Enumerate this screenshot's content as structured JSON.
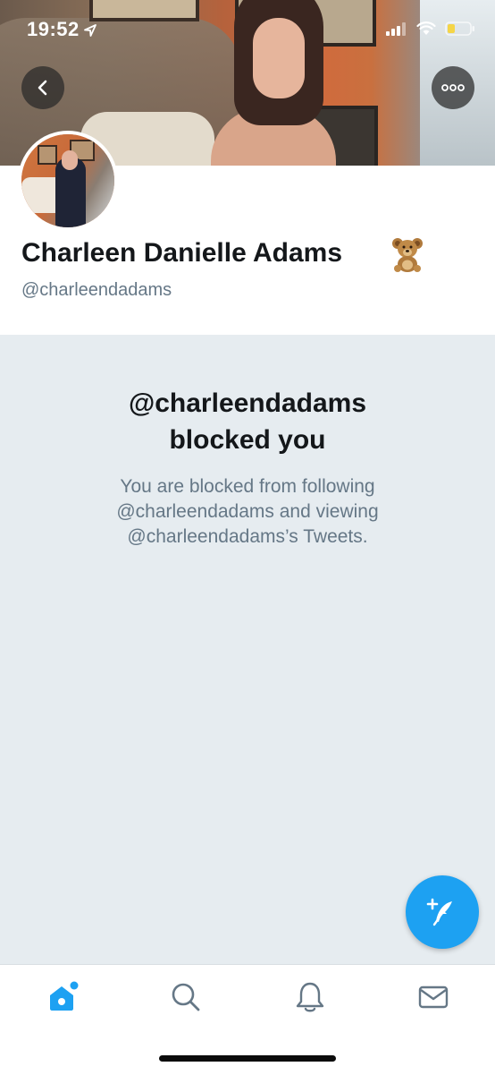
{
  "status_bar": {
    "time": "19:52"
  },
  "profile": {
    "display_name": "Charleen Danielle Adams",
    "handle": "@charleendadams"
  },
  "blocked": {
    "title_line1": "@charleendadams",
    "title_line2": "blocked you",
    "description_line1": "You are blocked from following",
    "description_line2": "@charleendadams and viewing",
    "description_line3": "@charleendadams’s Tweets."
  },
  "icons": {
    "location": "location-arrow-icon",
    "signal": "cellular-signal-icon",
    "wifi": "wifi-icon",
    "battery": "battery-icon",
    "back": "chevron-left-icon",
    "more": "more-options-icon",
    "emoji": "teddy-bear-emoji",
    "compose": "compose-tweet-icon",
    "home": "home-icon",
    "search": "search-icon",
    "notifications": "bell-icon",
    "messages": "envelope-icon"
  },
  "colors": {
    "accent": "#1da1f2",
    "panel_background": "#e6ecf0",
    "secondary_text": "#657786",
    "primary_text": "#14171a",
    "battery_level": "#f5d547"
  }
}
